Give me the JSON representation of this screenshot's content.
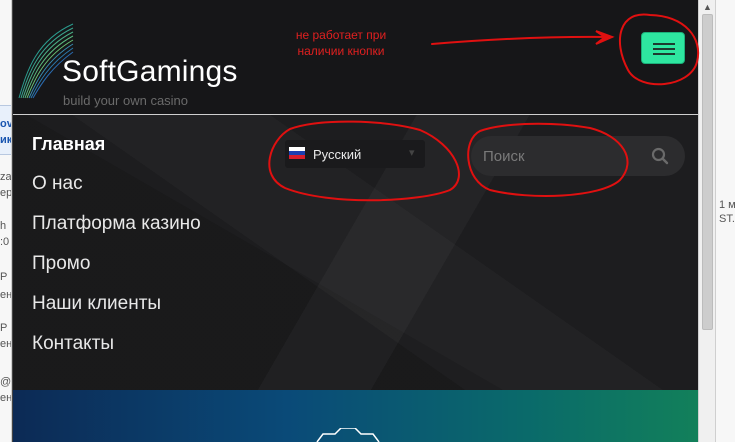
{
  "left_window": {
    "fragments": [
      "ov",
      "ику",
      "zai",
      "ер",
      "h",
      ":0",
      "P",
      "ен",
      "P",
      "ен",
      "@",
      "ен"
    ]
  },
  "right_window": {
    "fragments": [
      "1 м",
      "ST."
    ]
  },
  "header": {
    "brand": "SoftGamings",
    "tagline": "build your own casino",
    "annotation": "не работает при наличии кнопки",
    "menu_button_icon": "hamburger-icon",
    "accent_color": "#2ee6a0"
  },
  "nav": {
    "items": [
      "Главная",
      "О нас",
      "Платформа казино",
      "Промо",
      "Наши клиенты",
      "Контакты"
    ]
  },
  "language": {
    "selected": "Русский",
    "flag_icon": "russia-flag-icon"
  },
  "search": {
    "placeholder": "Поиск",
    "icon": "search-icon"
  },
  "annotation_color": "#e02020"
}
